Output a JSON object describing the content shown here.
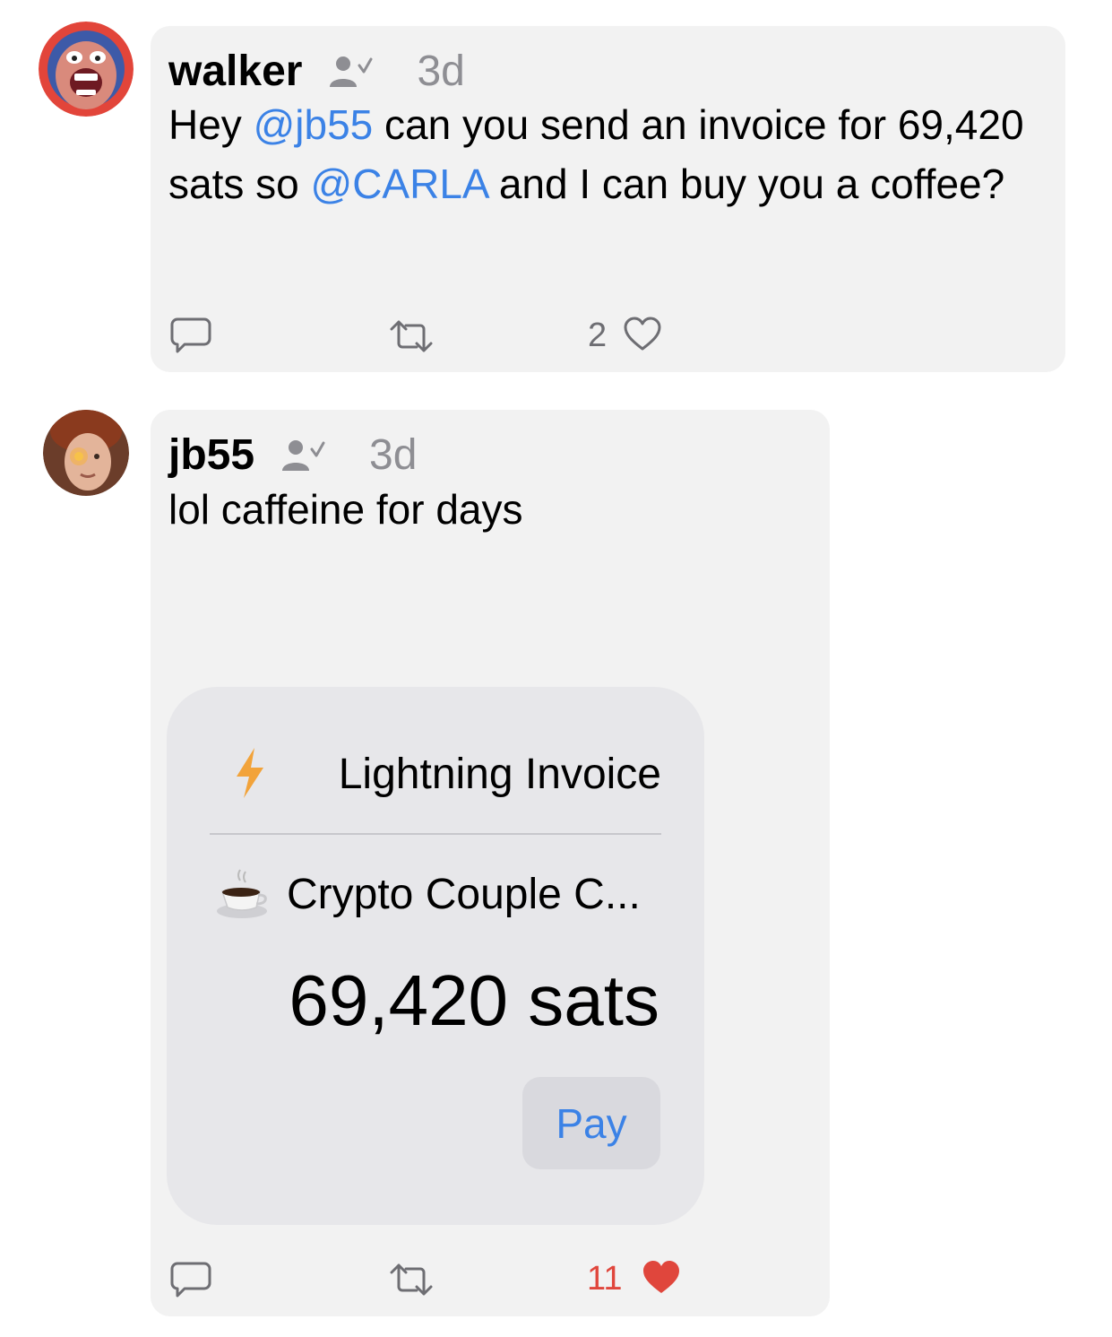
{
  "posts": [
    {
      "username": "walker",
      "friend_icon": "person-check-icon",
      "time": "3d",
      "content": {
        "pre": "Hey ",
        "mention1": "@jb55",
        "mid": " can you send an invoice for 69,420 sats so ",
        "mention2": "@CARLA",
        "post": " and I can buy you a coffee?"
      },
      "actions": {
        "reply_icon": "reply-icon",
        "repost_icon": "repost-icon",
        "like_count": "2",
        "like_icon": "heart-outline-icon",
        "liked": false
      }
    },
    {
      "username": "jb55",
      "friend_icon": "person-check-icon",
      "time": "3d",
      "content": "lol caffeine for days",
      "invoice": {
        "icon": "lightning-bolt-icon",
        "title": "Lightning Invoice",
        "desc_icon": "coffee-cup-icon",
        "description": "Crypto Couple C...",
        "amount": "69,420 sats",
        "pay_label": "Pay"
      },
      "actions": {
        "reply_icon": "reply-icon",
        "repost_icon": "repost-icon",
        "like_count": "11",
        "like_icon": "heart-filled-icon",
        "liked": true
      }
    }
  ],
  "colors": {
    "mention": "#3b82e6",
    "muted": "#8e8e93",
    "bubble": "#f2f2f2",
    "invoice_bg": "#e7e7ea",
    "liked": "#e0463c",
    "lightning": "#f2a33a"
  }
}
